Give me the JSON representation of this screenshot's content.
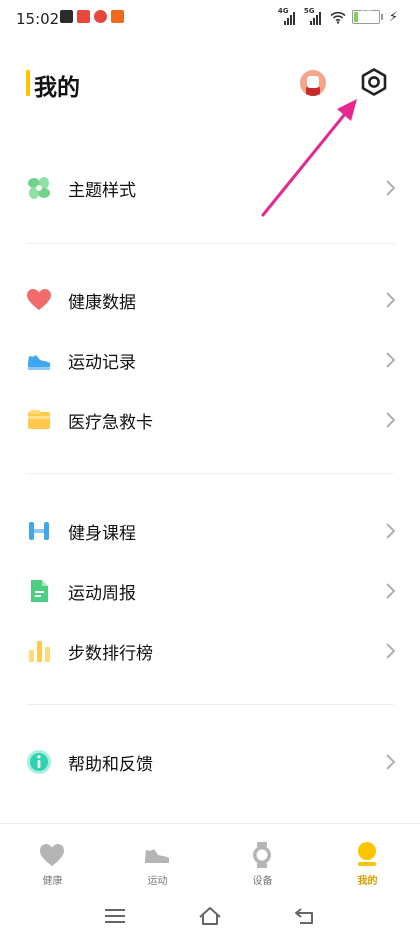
{
  "status_bar": {
    "time": "15:02",
    "signal_labels": [
      "4G",
      "5G"
    ],
    "battery_level": "17",
    "battery_fraction": 0.17,
    "app_icon_colors": [
      "#2b2b2b",
      "#e8473d",
      "#e8473d",
      "#ef6a1c"
    ]
  },
  "header": {
    "title": "我的",
    "accent_color": "#ffc300",
    "icons": [
      "avatar",
      "settings-icon"
    ]
  },
  "sections": [
    {
      "items": [
        {
          "label": "主题样式",
          "icon": "theme-icon",
          "color": "#6fd38c"
        }
      ]
    },
    {
      "items": [
        {
          "label": "健康数据",
          "icon": "heart-icon",
          "color": "#f26b6b"
        },
        {
          "label": "运动记录",
          "icon": "sneaker-icon",
          "color": "#3fa6f0"
        },
        {
          "label": "医疗急救卡",
          "icon": "card-icon",
          "color": "#ffc94a"
        }
      ]
    },
    {
      "items": [
        {
          "label": "健身课程",
          "icon": "dumbbell-icon",
          "color": "#3fa6f0"
        },
        {
          "label": "运动周报",
          "icon": "report-icon",
          "color": "#4ccf82"
        },
        {
          "label": "步数排行榜",
          "icon": "bar-chart-icon",
          "color": "#ffc94a"
        }
      ]
    },
    {
      "items": [
        {
          "label": "帮助和反馈",
          "icon": "info-icon",
          "color": "#2fd3b0"
        }
      ]
    }
  ],
  "bottom_nav": {
    "tabs": [
      {
        "label": "健康",
        "icon": "heart-icon",
        "active": false
      },
      {
        "label": "运动",
        "icon": "sneaker-icon",
        "active": false
      },
      {
        "label": "设备",
        "icon": "watch-icon",
        "active": false
      },
      {
        "label": "我的",
        "icon": "person-icon",
        "active": true
      }
    ],
    "active_color": "#ffc300",
    "inactive_color": "#b5b5b5"
  },
  "system_nav": [
    "menu-icon",
    "home-icon",
    "back-icon"
  ]
}
